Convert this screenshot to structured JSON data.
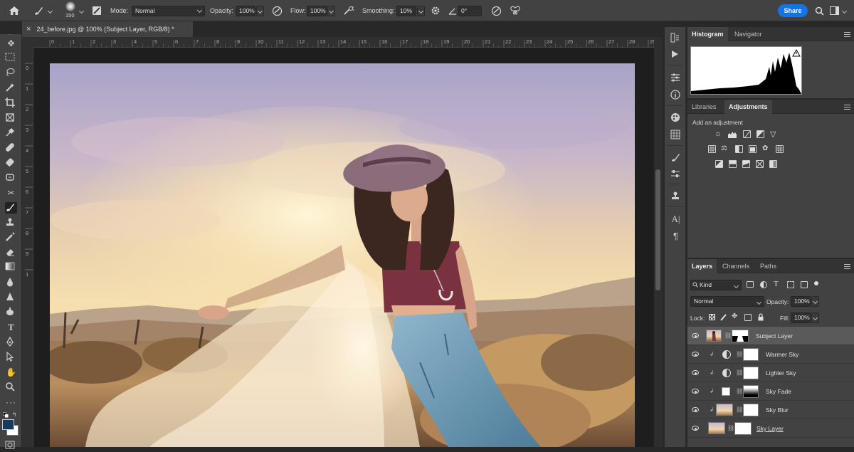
{
  "options_bar": {
    "brush_size": "150",
    "mode_label": "Mode:",
    "mode_value": "Normal",
    "opacity_label": "Opacity:",
    "opacity_value": "100%",
    "flow_label": "Flow:",
    "flow_value": "100%",
    "smoothing_label": "Smoothing:",
    "smoothing_value": "10%",
    "angle_value": "0°",
    "share_label": "Share"
  },
  "document": {
    "tab_title": "24_before.jpg @ 100% (Subject Layer, RGB/8) *",
    "close_glyph": "×"
  },
  "rulers": {
    "top": [
      "0",
      "1",
      "2",
      "3",
      "4",
      "5",
      "6",
      "7",
      "8",
      "9",
      "10",
      "11",
      "12",
      "13",
      "14",
      "15",
      "16",
      "17",
      "18",
      "19",
      "20",
      "21",
      "22",
      "23",
      "24",
      "25",
      "26",
      "27",
      "28",
      "29"
    ],
    "left": [
      "0",
      "1",
      "2",
      "3",
      "4",
      "5",
      "6",
      "7",
      "8",
      "9",
      "1"
    ]
  },
  "histogram_panel": {
    "tabs": [
      "Histogram",
      "Navigator"
    ],
    "active": "Histogram"
  },
  "adjustments_panel": {
    "tabs": [
      "Libraries",
      "Adjustments"
    ],
    "active": "Adjustments",
    "heading": "Add an adjustment"
  },
  "layers_panel": {
    "tabs": [
      "Layers",
      "Channels",
      "Paths"
    ],
    "active": "Layers",
    "filter_kind": "Kind",
    "blend_mode": "Normal",
    "opacity_label": "Opacity:",
    "opacity_value": "100%",
    "lock_label": "Lock:",
    "fill_label": "Fill:",
    "fill_value": "100%",
    "layers": [
      {
        "name": "Subject Layer",
        "selected": true
      },
      {
        "name": "Warmer Sky",
        "selected": false
      },
      {
        "name": "Lighter Sky",
        "selected": false
      },
      {
        "name": "Sky Fade",
        "selected": false
      },
      {
        "name": "Sky Blur",
        "selected": false
      },
      {
        "name": "Sky Layer",
        "selected": false
      }
    ]
  },
  "colors": {
    "accent": "#1473e6",
    "panel_bg": "#424242",
    "foreground_swatch": "#1a3a5c",
    "background_swatch": "#ffffff"
  }
}
